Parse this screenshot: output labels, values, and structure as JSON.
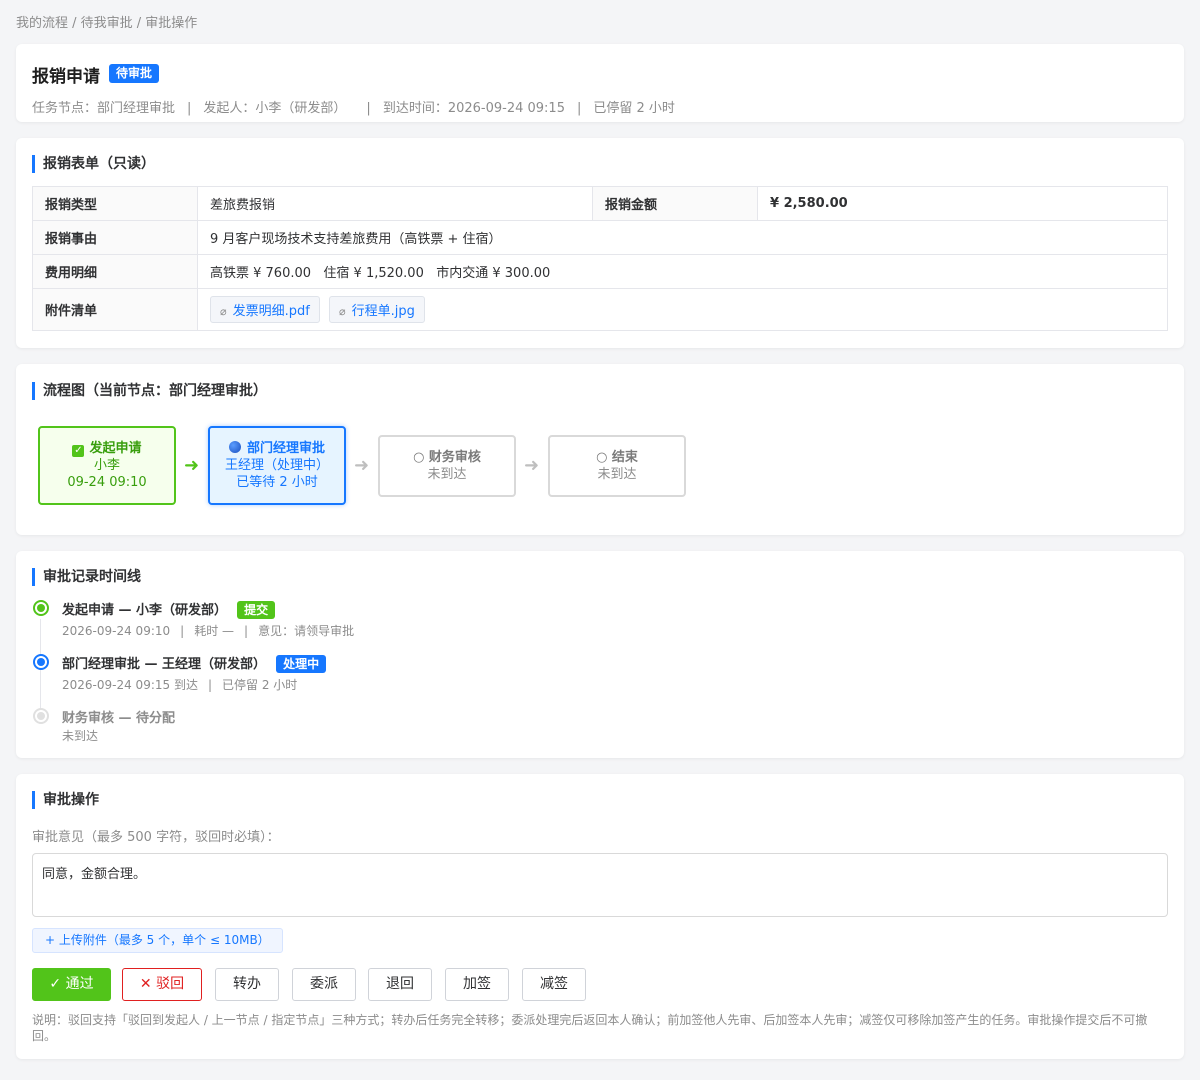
{
  "breadcrumb": "我的流程 / 待我审批 / 审批操作",
  "header": {
    "title": "报销申请",
    "status_badge": "待审批",
    "task_node": "任务节点：部门经理审批",
    "initiator": "发起人：小李（研发部）",
    "arrival_time": "到达时间：2026-09-24 09:15",
    "stay": "已停留 2 小时",
    "separator": "|"
  },
  "form": {
    "title": "报销表单（只读）",
    "type_label": "报销类型",
    "type_value": "差旅费报销",
    "amount_label": "报销金额",
    "amount_value": "¥ 2,580.00",
    "reason_label": "报销事由",
    "reason_value": "9 月客户现场技术支持差旅费用（高铁票 + 住宿）",
    "detail_label": "费用明细",
    "detail_value": "高铁票 ¥ 760.00   住宿 ¥ 1,520.00   市内交通 ¥ 300.00",
    "attach_label": "附件清单",
    "attachments": [
      "发票明细.pdf",
      "行程单.jpg"
    ]
  },
  "flow": {
    "title": "流程图（当前节点：部门经理审批）",
    "nodes": [
      {
        "title": "发起申请",
        "line1": "小李",
        "line2": "09-24 09:10",
        "state": "done"
      },
      {
        "title": "部门经理审批",
        "line1": "王经理（处理中）",
        "line2": "已等待 2 小时",
        "state": "active"
      },
      {
        "title": "○ 财务审核",
        "line1": "未到达",
        "state": "todo"
      },
      {
        "title": "○ 结束",
        "line1": "未到达",
        "state": "todo"
      }
    ],
    "arrow": "➜"
  },
  "timeline": {
    "title": "审批记录时间线",
    "items": [
      {
        "head": "发起申请 — 小李（研发部）",
        "tag": "提交",
        "time": "2026-09-24 09:10",
        "duration": "耗时 —",
        "opinion": "意见：请领导审批"
      },
      {
        "head": "部门经理审批 — 王经理（研发部）",
        "tag": "处理中",
        "time": "2026-09-24 09:15 到达",
        "stay": "已停留 2 小时"
      },
      {
        "head": "财务审核 — 待分配",
        "sub": "未到达"
      }
    ]
  },
  "actions": {
    "title": "审批操作",
    "opinion_label": "审批意见（最多 500 字符，驳回时必填）：",
    "opinion_value": "同意，金额合理。",
    "upload_label": "+ 上传附件（最多 5 个，单个 ≤ 10MB）",
    "buttons": {
      "pass": "✓ 通过",
      "reject": "✕ 驳回",
      "transfer": "转办",
      "delegate": "委派",
      "return": "退回",
      "add_sign": "加签",
      "remove_sign": "减签"
    },
    "note": "说明：驳回支持「驳回到发起人 / 上一节点 / 指定节点」三种方式；转办后任务完全转移；委派处理完后返回本人确认；前加签他人先审、后加签本人先审；减签仅可移除加签产生的任务。审批操作提交后不可撤回。"
  },
  "colors": {
    "primary": "#1677ff",
    "success": "#52c41a",
    "danger": "#e02020"
  }
}
